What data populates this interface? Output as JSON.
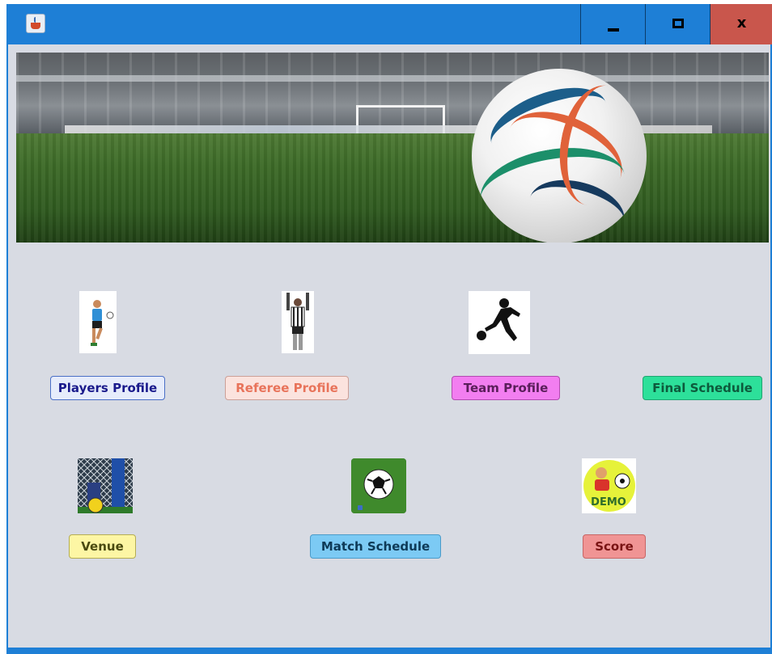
{
  "window": {
    "controls": {
      "minimize_icon": "minimize-icon",
      "maximize_icon": "maximize-icon",
      "close_glyph": "x"
    }
  },
  "banner": {
    "icon": "soccer-ball-stadium-image"
  },
  "buttons": {
    "players_profile": {
      "label": "Players Profile",
      "color": "#1a1a8c",
      "bg": "#e6ecfb",
      "border": "#4a6fc6"
    },
    "referee_profile": {
      "label": "Referee Profile",
      "color": "#e8735a",
      "bg": "#fbe3de",
      "border": "#cc9f97"
    },
    "team_profile": {
      "label": "Team Profile",
      "color": "#5a1e5a",
      "bg": "#f27ef0",
      "border": "#b24ab0"
    },
    "final_schedule": {
      "label": "Final Schedule",
      "color": "#0d5a3c",
      "bg": "#2de09a",
      "border": "#1fa571"
    },
    "venue": {
      "label": "Venue",
      "color": "#4a4a10",
      "bg": "#fdf6a4",
      "border": "#b5ad53"
    },
    "match_schedule": {
      "label": "Match Schedule",
      "color": "#0e3a57",
      "bg": "#7ccaf4",
      "border": "#4b9bc9"
    },
    "score": {
      "label": "Score",
      "color": "#7a1414",
      "bg": "#f09494",
      "border": "#c66565"
    }
  },
  "icons": {
    "player": "player-icon",
    "referee": "referee-icon",
    "team": "kicker-silhouette-icon",
    "venue": "goal-net-icon",
    "match": "soccer-ball-icon",
    "score": "cartoon-player-icon"
  }
}
